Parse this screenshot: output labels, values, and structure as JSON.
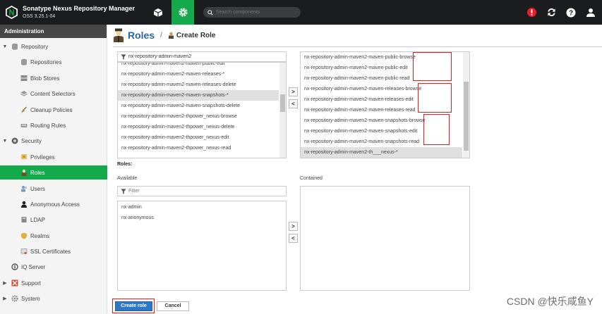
{
  "header": {
    "app_name": "Sonatype Nexus Repository Manager",
    "version": "OSS 3.25.1-04",
    "search_placeholder": "Search components"
  },
  "sidebar": {
    "title": "Administration",
    "items": [
      {
        "label": "Repository"
      },
      {
        "label": "Repositories"
      },
      {
        "label": "Blob Stores"
      },
      {
        "label": "Content Selectors"
      },
      {
        "label": "Cleanup Policies"
      },
      {
        "label": "Routing Rules"
      },
      {
        "label": "Security"
      },
      {
        "label": "Privileges"
      },
      {
        "label": "Roles"
      },
      {
        "label": "Users"
      },
      {
        "label": "Anonymous Access"
      },
      {
        "label": "LDAP"
      },
      {
        "label": "Realms"
      },
      {
        "label": "SSL Certificates"
      },
      {
        "label": "IQ Server"
      },
      {
        "label": "Support"
      },
      {
        "label": "System"
      }
    ]
  },
  "breadcrumb": {
    "title": "Roles",
    "separator": "/",
    "sub": "Create Role"
  },
  "privileges": {
    "filter_value": "nx-repository-admin-maven2",
    "available": [
      "nx-repository-admin-maven2-maven-public-edit",
      "nx-repository-admin-maven2-maven-releases-*",
      "nx-repository-admin-maven2-maven-releases-delete",
      "nx-repository-admin-maven2-maven-snapshots-*",
      "nx-repository-admin-maven2-maven-snapshots-delete",
      "nx-repository-admin-maven2-thpower_nexus-browse",
      "nx-repository-admin-maven2-thpower_nexus-delete",
      "nx-repository-admin-maven2-thpower_nexus-edit",
      "nx-repository-admin-maven2-thpower_nexus-read"
    ],
    "contained": [
      "nx-repository-admin-maven2-maven-public-browse",
      "nx-repository-admin-maven2-maven-public-edit",
      "nx-repository-admin-maven2-maven-public-read",
      "nx-repository-admin-maven2-maven-releases-browse",
      "nx-repository-admin-maven2-maven-releases-edit",
      "nx-repository-admin-maven2-maven-releases-read",
      "nx-repository-admin-maven2-maven-snapshots-browse",
      "nx-repository-admin-maven2-maven-snapshots-edit",
      "nx-repository-admin-maven2-maven-snapshots-read",
      "nx-repository-admin-maven2-th___nexus-*"
    ]
  },
  "roles": {
    "label": "Roles:",
    "available_label": "Available",
    "contained_label": "Contained",
    "filter_placeholder": "Filter",
    "available": [
      "nx-admin",
      "nx-anonymous"
    ]
  },
  "buttons": {
    "create": "Create role",
    "cancel": "Cancel",
    "move_right": ">",
    "move_left": "<"
  },
  "watermark": "CSDN @快乐咸鱼Y",
  "colors": {
    "header_bg": "#1b1c1d",
    "accent_green": "#14a94b",
    "primary_blue": "#2d77c4",
    "highlight_red": "#e02020"
  }
}
